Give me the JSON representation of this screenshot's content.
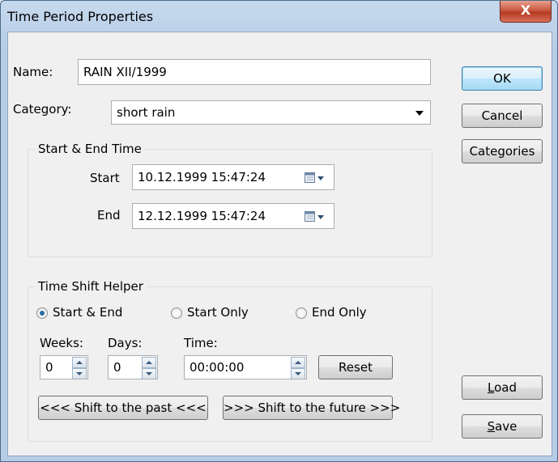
{
  "window": {
    "title": "Time Period Properties",
    "close_label": "X"
  },
  "form": {
    "name_label": "Name:",
    "name_value": "RAIN XII/1999",
    "category_label": "Category:",
    "category_value": "short rain"
  },
  "start_end": {
    "title": "Start & End Time",
    "start_label": "Start",
    "start_value": "10.12.1999 15:47:24",
    "end_label": "End",
    "end_value": "12.12.1999 15:47:24"
  },
  "shift_helper": {
    "title": "Time Shift Helper",
    "options": [
      "Start & End",
      "Start Only",
      "End Only"
    ],
    "selected_option": "Start & End",
    "weeks_label": "Weeks:",
    "weeks_value": "0",
    "days_label": "Days:",
    "days_value": "0",
    "time_label": "Time:",
    "time_value": "00:00:00",
    "reset_label": "Reset",
    "past_label": "<<< Shift to the past <<<",
    "future_label": ">>> Shift to the future >>>"
  },
  "buttons": {
    "ok": "OK",
    "cancel": "Cancel",
    "categories": "Categories",
    "load_prefix": "L",
    "load_rest": "oad",
    "save_prefix": "S",
    "save_rest": "ave"
  }
}
